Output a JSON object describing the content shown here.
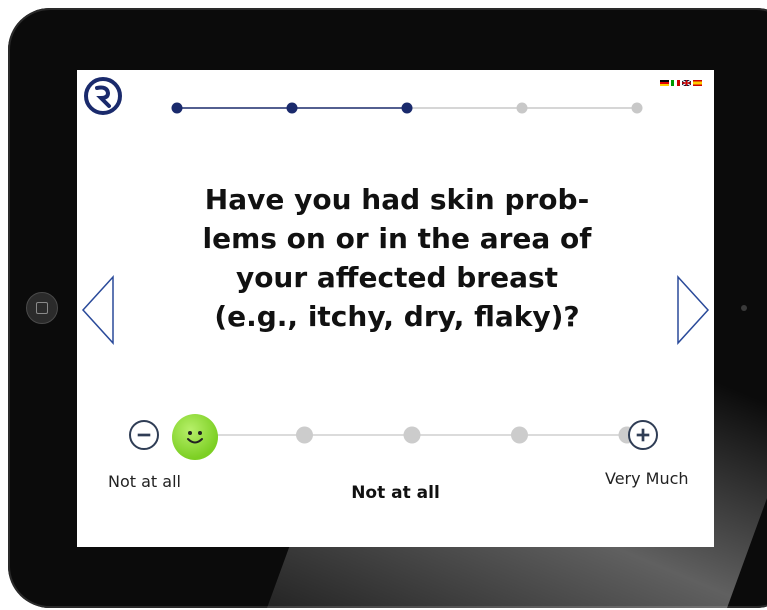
{
  "app": {
    "languages": [
      "de",
      "it",
      "uk",
      "es"
    ]
  },
  "progress": {
    "total_steps": 5,
    "completed_steps": 3,
    "active_color": "#1a2a6c",
    "inactive_color": "#c8c8c8"
  },
  "question": {
    "lines": [
      "Have you had skin prob-",
      "lems on or in the area of",
      "your affected breast",
      "(e.g., itchy, dry, flaky)?"
    ]
  },
  "navigation": {
    "prev_icon": "chevron-left-icon",
    "next_icon": "chevron-right-icon",
    "arrow_color": "#2a4a9a"
  },
  "scale": {
    "min_label": "Not at all",
    "max_label": "Very Much",
    "selected_label": "Not at all",
    "steps": 5,
    "selected_index": 0,
    "decrease_icon": "minus-icon",
    "increase_icon": "plus-icon",
    "selected_color": "#7ccf23"
  }
}
